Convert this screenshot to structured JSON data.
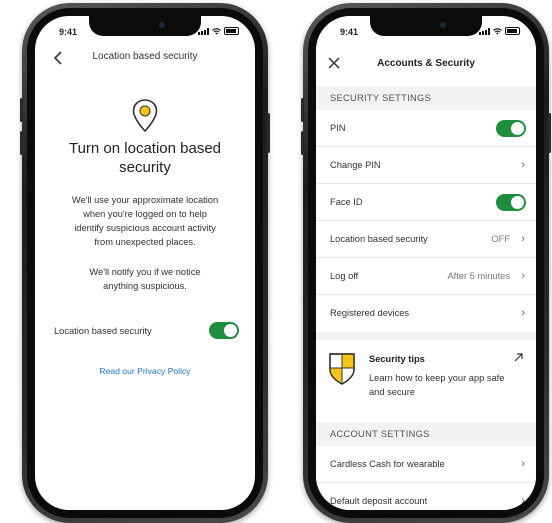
{
  "left": {
    "status_time": "9:41",
    "title": "Location based security",
    "heading": "Turn on location based security",
    "body_lines": [
      "We'll use your approximate location",
      "when you're logged on to help",
      "identify suspicious account activity",
      "from unexpected places."
    ],
    "body2_lines": [
      "We'll notify you if we notice",
      "anything suspicious."
    ],
    "toggle_label": "Location based security",
    "toggle_on": true,
    "privacy_link": "Read our Privacy Policy",
    "accent_color": "#1e8e3e",
    "pin_color": "#f5c518"
  },
  "right": {
    "status_time": "9:41",
    "title": "Accounts & Security",
    "security_section": "SECURITY SETTINGS",
    "rows": [
      {
        "label": "PIN",
        "type": "toggle",
        "on": true
      },
      {
        "label": "Change PIN",
        "type": "chevron"
      },
      {
        "label": "Face ID",
        "type": "toggle",
        "on": true
      },
      {
        "label": "Location based security",
        "value": "OFF",
        "type": "chevron"
      },
      {
        "label": "Log off",
        "value": "After 5 minutes",
        "type": "chevron"
      },
      {
        "label": "Registered devices",
        "type": "chevron"
      }
    ],
    "tips": {
      "title": "Security tips",
      "body": "Learn how to keep your app safe and secure"
    },
    "account_section": "ACCOUNT SETTINGS",
    "account_rows": [
      {
        "label": "Cardless Cash for wearable"
      },
      {
        "label": "Default deposit account"
      }
    ]
  }
}
